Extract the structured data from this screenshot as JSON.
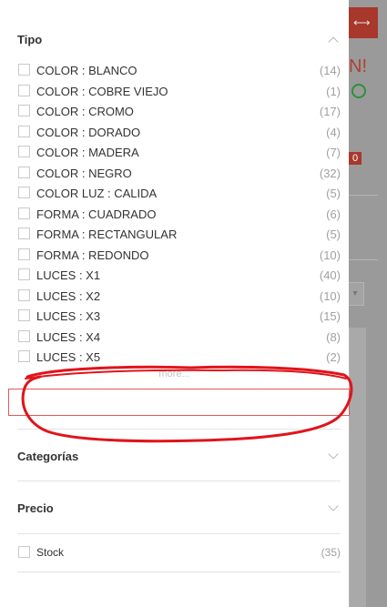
{
  "background_page": {
    "promo_fragment": "N!",
    "cart_count": "0"
  },
  "tipo": {
    "title": "Tipo",
    "items": [
      {
        "label": "COLOR : BLANCO",
        "count": "(14)"
      },
      {
        "label": "COLOR : COBRE VIEJO",
        "count": "(1)"
      },
      {
        "label": "COLOR : CROMO",
        "count": "(17)"
      },
      {
        "label": "COLOR : DORADO",
        "count": "(4)"
      },
      {
        "label": "COLOR : MADERA",
        "count": "(7)"
      },
      {
        "label": "COLOR : NEGRO",
        "count": "(32)"
      },
      {
        "label": "COLOR LUZ : CALIDA",
        "count": "(5)"
      },
      {
        "label": "FORMA : CUADRADO",
        "count": "(6)"
      },
      {
        "label": "FORMA : RECTANGULAR",
        "count": "(5)"
      },
      {
        "label": "FORMA : REDONDO",
        "count": "(10)"
      },
      {
        "label": "LUCES : X1",
        "count": "(40)"
      },
      {
        "label": "LUCES : X2",
        "count": "(10)"
      },
      {
        "label": "LUCES : X3",
        "count": "(15)"
      },
      {
        "label": "LUCES : X4",
        "count": "(8)"
      },
      {
        "label": "LUCES : X5",
        "count": "(2)"
      }
    ],
    "more_label": "more..."
  },
  "categorias": {
    "title": "Categorías"
  },
  "precio": {
    "title": "Precio"
  },
  "stock": {
    "label": "Stock",
    "count": "(35)"
  },
  "colors": {
    "annotation_red": "#e0141a",
    "highlight_border": "#e05a5a"
  }
}
